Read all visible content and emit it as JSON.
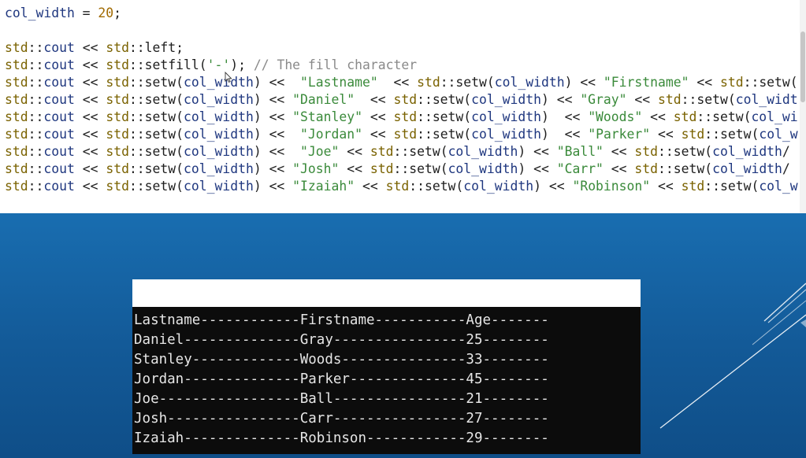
{
  "code": {
    "lines": [
      [
        {
          "t": "col_width",
          "c": "var"
        },
        {
          "t": " = ",
          "c": "op"
        },
        {
          "t": "20",
          "c": "num"
        },
        {
          "t": ";",
          "c": "op"
        }
      ],
      [],
      [
        {
          "t": "std",
          "c": "ns"
        },
        {
          "t": "::",
          "c": "op"
        },
        {
          "t": "cout",
          "c": "var"
        },
        {
          "t": " << ",
          "c": "op"
        },
        {
          "t": "std",
          "c": "ns"
        },
        {
          "t": "::left;",
          "c": "op"
        }
      ],
      [
        {
          "t": "std",
          "c": "ns"
        },
        {
          "t": "::",
          "c": "op"
        },
        {
          "t": "cout",
          "c": "var"
        },
        {
          "t": " << ",
          "c": "op"
        },
        {
          "t": "std",
          "c": "ns"
        },
        {
          "t": "::setfill(",
          "c": "op"
        },
        {
          "t": "'-'",
          "c": "str"
        },
        {
          "t": "); ",
          "c": "op"
        },
        {
          "t": "// The fill character",
          "c": "cmt"
        }
      ],
      [
        {
          "t": "std",
          "c": "ns"
        },
        {
          "t": "::",
          "c": "op"
        },
        {
          "t": "cout",
          "c": "var"
        },
        {
          "t": " << ",
          "c": "op"
        },
        {
          "t": "std",
          "c": "ns"
        },
        {
          "t": "::setw(",
          "c": "op"
        },
        {
          "t": "col_width",
          "c": "var"
        },
        {
          "t": ") <<  ",
          "c": "op"
        },
        {
          "t": "\"Lastname\"",
          "c": "str"
        },
        {
          "t": "  << ",
          "c": "op"
        },
        {
          "t": "std",
          "c": "ns"
        },
        {
          "t": "::setw(",
          "c": "op"
        },
        {
          "t": "col_width",
          "c": "var"
        },
        {
          "t": ") << ",
          "c": "op"
        },
        {
          "t": "\"Firstname\"",
          "c": "str"
        },
        {
          "t": " << ",
          "c": "op"
        },
        {
          "t": "std",
          "c": "ns"
        },
        {
          "t": "::setw(",
          "c": "op"
        }
      ],
      [
        {
          "t": "std",
          "c": "ns"
        },
        {
          "t": "::",
          "c": "op"
        },
        {
          "t": "cout",
          "c": "var"
        },
        {
          "t": " << ",
          "c": "op"
        },
        {
          "t": "std",
          "c": "ns"
        },
        {
          "t": "::setw(",
          "c": "op"
        },
        {
          "t": "col_width",
          "c": "var"
        },
        {
          "t": ") << ",
          "c": "op"
        },
        {
          "t": "\"Daniel\"",
          "c": "str"
        },
        {
          "t": "  << ",
          "c": "op"
        },
        {
          "t": "std",
          "c": "ns"
        },
        {
          "t": "::setw(",
          "c": "op"
        },
        {
          "t": "col_width",
          "c": "var"
        },
        {
          "t": ") << ",
          "c": "op"
        },
        {
          "t": "\"Gray\"",
          "c": "str"
        },
        {
          "t": " << ",
          "c": "op"
        },
        {
          "t": "std",
          "c": "ns"
        },
        {
          "t": "::setw(",
          "c": "op"
        },
        {
          "t": "col_widt",
          "c": "var"
        }
      ],
      [
        {
          "t": "std",
          "c": "ns"
        },
        {
          "t": "::",
          "c": "op"
        },
        {
          "t": "cout",
          "c": "var"
        },
        {
          "t": " << ",
          "c": "op"
        },
        {
          "t": "std",
          "c": "ns"
        },
        {
          "t": "::setw(",
          "c": "op"
        },
        {
          "t": "col_width",
          "c": "var"
        },
        {
          "t": ") << ",
          "c": "op"
        },
        {
          "t": "\"Stanley\"",
          "c": "str"
        },
        {
          "t": " << ",
          "c": "op"
        },
        {
          "t": "std",
          "c": "ns"
        },
        {
          "t": "::setw(",
          "c": "op"
        },
        {
          "t": "col_width",
          "c": "var"
        },
        {
          "t": ")  << ",
          "c": "op"
        },
        {
          "t": "\"Woods\"",
          "c": "str"
        },
        {
          "t": " << ",
          "c": "op"
        },
        {
          "t": "std",
          "c": "ns"
        },
        {
          "t": "::setw(",
          "c": "op"
        },
        {
          "t": "col_wi",
          "c": "var"
        }
      ],
      [
        {
          "t": "std",
          "c": "ns"
        },
        {
          "t": "::",
          "c": "op"
        },
        {
          "t": "cout",
          "c": "var"
        },
        {
          "t": " << ",
          "c": "op"
        },
        {
          "t": "std",
          "c": "ns"
        },
        {
          "t": "::setw(",
          "c": "op"
        },
        {
          "t": "col_width",
          "c": "var"
        },
        {
          "t": ") <<  ",
          "c": "op"
        },
        {
          "t": "\"Jordan\"",
          "c": "str"
        },
        {
          "t": " << ",
          "c": "op"
        },
        {
          "t": "std",
          "c": "ns"
        },
        {
          "t": "::setw(",
          "c": "op"
        },
        {
          "t": "col_width",
          "c": "var"
        },
        {
          "t": ")  << ",
          "c": "op"
        },
        {
          "t": "\"Parker\"",
          "c": "str"
        },
        {
          "t": " << ",
          "c": "op"
        },
        {
          "t": "std",
          "c": "ns"
        },
        {
          "t": "::setw(",
          "c": "op"
        },
        {
          "t": "col_w",
          "c": "var"
        }
      ],
      [
        {
          "t": "std",
          "c": "ns"
        },
        {
          "t": "::",
          "c": "op"
        },
        {
          "t": "cout",
          "c": "var"
        },
        {
          "t": " << ",
          "c": "op"
        },
        {
          "t": "std",
          "c": "ns"
        },
        {
          "t": "::setw(",
          "c": "op"
        },
        {
          "t": "col_width",
          "c": "var"
        },
        {
          "t": ") <<  ",
          "c": "op"
        },
        {
          "t": "\"Joe\"",
          "c": "str"
        },
        {
          "t": " << ",
          "c": "op"
        },
        {
          "t": "std",
          "c": "ns"
        },
        {
          "t": "::setw(",
          "c": "op"
        },
        {
          "t": "col_width",
          "c": "var"
        },
        {
          "t": ") << ",
          "c": "op"
        },
        {
          "t": "\"Ball\"",
          "c": "str"
        },
        {
          "t": " << ",
          "c": "op"
        },
        {
          "t": "std",
          "c": "ns"
        },
        {
          "t": "::setw(",
          "c": "op"
        },
        {
          "t": "col_width",
          "c": "var"
        },
        {
          "t": "/",
          "c": "op"
        }
      ],
      [
        {
          "t": "std",
          "c": "ns"
        },
        {
          "t": "::",
          "c": "op"
        },
        {
          "t": "cout",
          "c": "var"
        },
        {
          "t": " << ",
          "c": "op"
        },
        {
          "t": "std",
          "c": "ns"
        },
        {
          "t": "::setw(",
          "c": "op"
        },
        {
          "t": "col_width",
          "c": "var"
        },
        {
          "t": ") << ",
          "c": "op"
        },
        {
          "t": "\"Josh\"",
          "c": "str"
        },
        {
          "t": " << ",
          "c": "op"
        },
        {
          "t": "std",
          "c": "ns"
        },
        {
          "t": "::setw(",
          "c": "op"
        },
        {
          "t": "col_width",
          "c": "var"
        },
        {
          "t": ") << ",
          "c": "op"
        },
        {
          "t": "\"Carr\"",
          "c": "str"
        },
        {
          "t": " << ",
          "c": "op"
        },
        {
          "t": "std",
          "c": "ns"
        },
        {
          "t": "::setw(",
          "c": "op"
        },
        {
          "t": "col_width",
          "c": "var"
        },
        {
          "t": "/",
          "c": "op"
        }
      ],
      [
        {
          "t": "std",
          "c": "ns"
        },
        {
          "t": "::",
          "c": "op"
        },
        {
          "t": "cout",
          "c": "var"
        },
        {
          "t": " << ",
          "c": "op"
        },
        {
          "t": "std",
          "c": "ns"
        },
        {
          "t": "::setw(",
          "c": "op"
        },
        {
          "t": "col_width",
          "c": "var"
        },
        {
          "t": ") << ",
          "c": "op"
        },
        {
          "t": "\"Izaiah\"",
          "c": "str"
        },
        {
          "t": " << ",
          "c": "op"
        },
        {
          "t": "std",
          "c": "ns"
        },
        {
          "t": "::setw(",
          "c": "op"
        },
        {
          "t": "col_width",
          "c": "var"
        },
        {
          "t": ") << ",
          "c": "op"
        },
        {
          "t": "\"Robinson\"",
          "c": "str"
        },
        {
          "t": " << ",
          "c": "op"
        },
        {
          "t": "std",
          "c": "ns"
        },
        {
          "t": "::setw(",
          "c": "op"
        },
        {
          "t": "col_w",
          "c": "var"
        }
      ]
    ]
  },
  "console": {
    "lines": [
      "Lastname------------Firstname-----------Age-------",
      "Daniel--------------Gray----------------25--------",
      "Stanley-------------Woods---------------33--------",
      "Jordan--------------Parker--------------45--------",
      "Joe-----------------Ball----------------21--------",
      "Josh----------------Carr----------------27--------",
      "Izaiah--------------Robinson------------29--------"
    ]
  },
  "colors": {
    "background_top": "#1f86c9",
    "background_bottom": "#0f4e88",
    "console_background": "#0c0c0c",
    "console_text": "#e6e6e6",
    "code_namespace": "#7a6200",
    "code_identifier": "#1f377f",
    "code_number": "#a06a00",
    "code_string": "#3a8a3a",
    "code_comment": "#8a8a8a"
  },
  "icons": {
    "mouse_cursor": "cursor-arrow-icon"
  }
}
